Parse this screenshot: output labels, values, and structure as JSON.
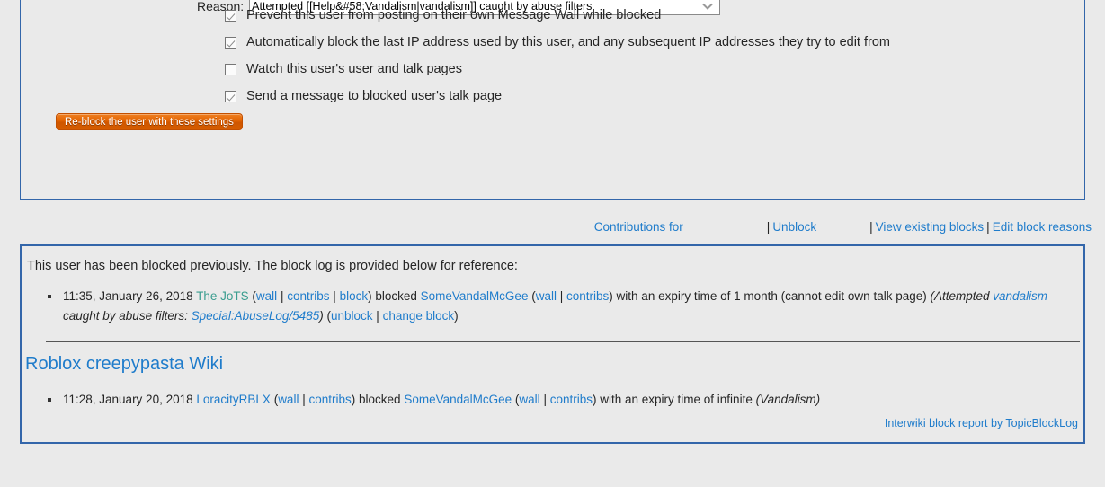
{
  "form": {
    "reason_label": "Reason:",
    "reason_selected": "Attempted [[Help&#58;Vandalism|vandalism]] caught by abuse filters",
    "reason_options": [
      "Attempted [[Help&#58;Vandalism|vandalism]] caught by abuse filters"
    ],
    "reason_other_value": "[[Special:AbuseLog/5485]]",
    "reason_other_placeholder": "",
    "checkboxes": [
      {
        "label": "Prevent this user from posting on their own Message Wall while blocked",
        "checked": true
      },
      {
        "label": "Automatically block the last IP address used by this user, and any subsequent IP addresses they try to edit from",
        "checked": true
      },
      {
        "label": "Watch this user's user and talk pages",
        "checked": false
      },
      {
        "label": "Send a message to blocked user's talk page",
        "checked": true
      }
    ],
    "submit_label": "Re-block the user with these settings"
  },
  "tool_links": {
    "contributions": "Contributions for",
    "unblock": "Unblock",
    "view_existing_blocks": "View existing blocks",
    "edit_block_reasons": "Edit block reasons",
    "separator": "|"
  },
  "log": {
    "intro": "This user has been blocked previously. The block log is provided below for reference:",
    "entry1": {
      "timestamp": "11:35, January 26, 2018",
      "admin": "The JoTS",
      "admin_wall": "wall",
      "admin_contribs": "contribs",
      "admin_block": "block",
      "action": "blocked",
      "target": "SomeVandalMcGee",
      "target_wall": "wall",
      "target_contribs": "contribs",
      "expiry": "with an expiry time of 1 month (cannot edit own talk page)",
      "comment_pre": "(Attempted ",
      "comment_link": "vandalism",
      "comment_mid": " caught by abuse filters: ",
      "comment_link2": "Special:AbuseLog/5485",
      "comment_post": ")",
      "unblock": "unblock",
      "change_block": "change block"
    },
    "wiki_heading": "Roblox creepypasta Wiki",
    "entry2": {
      "timestamp": "11:28, January 20, 2018",
      "admin": "LoracityRBLX",
      "admin_wall": "wall",
      "admin_contribs": "contribs",
      "action": "blocked",
      "target": "SomeVandalMcGee",
      "target_wall": "wall",
      "target_contribs": "contribs",
      "expiry": "with an expiry time of infinite",
      "comment": "(Vandalism)"
    },
    "footer": "Interwiki block report by TopicBlockLog"
  },
  "icons": {
    "chevron_down": "chevron-down-icon"
  },
  "colors": {
    "link": "#1f7ccb",
    "user_green": "#3a9d8f",
    "border_blue": "#3366aa",
    "button_orange": "#e06000",
    "page_bg": "#eaeaea"
  }
}
